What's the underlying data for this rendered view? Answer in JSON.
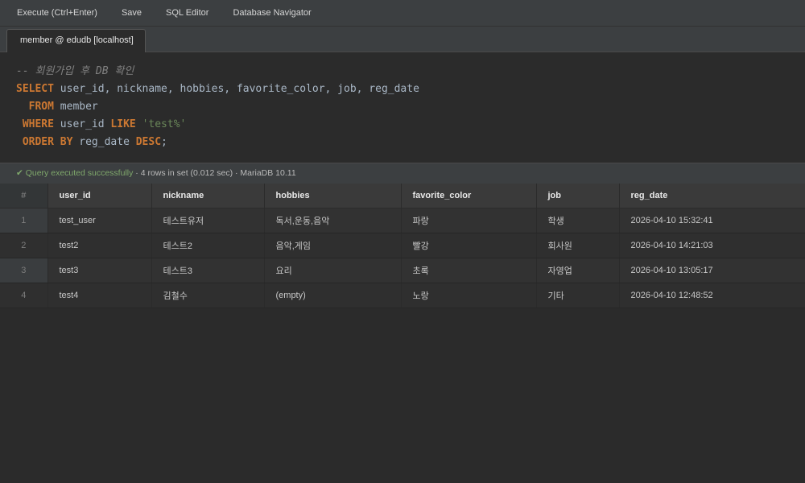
{
  "toolbar": {
    "execute_label": "Execute (Ctrl+Enter)",
    "save_label": "Save",
    "sql_editor_label": "SQL Editor",
    "db_navigator_label": "Database Navigator"
  },
  "tab": {
    "label": "member @ edudb [localhost]"
  },
  "editor": {
    "comment": "-- 회원가입 후 DB 확인",
    "line1": {
      "kw": "SELECT",
      "rest": " user_id, nickname, hobbies, favorite_color, job, reg_date"
    },
    "line2": {
      "indent": "  ",
      "kw": "FROM",
      "rest": " member"
    },
    "line3": {
      "indent": " ",
      "kw": "WHERE",
      "mid": " user_id ",
      "kw2": "LIKE",
      "sp": " ",
      "str": "'test%'"
    },
    "line4": {
      "indent": " ",
      "kw": "ORDER BY",
      "mid": " reg_date ",
      "kw2": "DESC",
      "end": ";"
    }
  },
  "status": {
    "success": "✔ Query executed successfully",
    "details": " · 4 rows in set (0.012 sec) · MariaDB 10.11"
  },
  "colors": {
    "keyword": "#cc7832",
    "string": "#6a8759",
    "comment": "#808080",
    "success": "#7fa86b"
  },
  "grid": {
    "rownum_header": "#",
    "headers": [
      "user_id",
      "nickname",
      "hobbies",
      "favorite_color",
      "job",
      "reg_date"
    ],
    "rows": [
      [
        "1",
        "test_user",
        "테스트유저",
        "독서,운동,음악",
        "파랑",
        "학생",
        "2026-04-10 15:32:41"
      ],
      [
        "2",
        "test2",
        "테스트2",
        "음악,게임",
        "빨강",
        "회사원",
        "2026-04-10 14:21:03"
      ],
      [
        "3",
        "test3",
        "테스트3",
        "요리",
        "초록",
        "자영업",
        "2026-04-10 13:05:17"
      ],
      [
        "4",
        "test4",
        "김철수",
        "(empty)",
        "노랑",
        "기타",
        "2026-04-10 12:48:52"
      ]
    ]
  }
}
